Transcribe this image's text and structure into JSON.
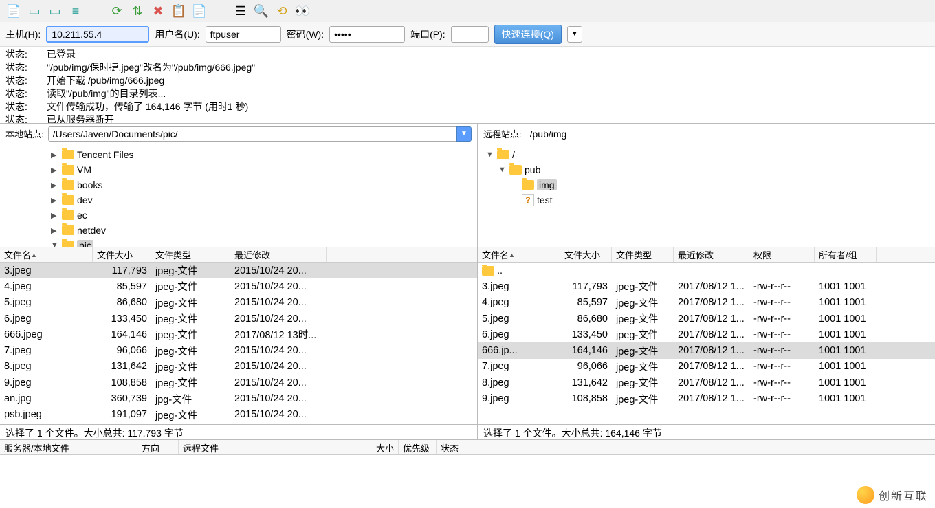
{
  "connect": {
    "host_label": "主机(H):",
    "host_value": "10.211.55.4",
    "user_label": "用户名(U):",
    "user_value": "ftpuser",
    "pass_label": "密码(W):",
    "pass_value": "•••••",
    "port_label": "端口(P):",
    "port_value": "",
    "quick_connect": "快速连接(Q)"
  },
  "log": [
    {
      "label": "状态:",
      "msg": "已登录"
    },
    {
      "label": "状态:",
      "msg": "\"/pub/img/保时捷.jpeg\"改名为\"/pub/img/666.jpeg\""
    },
    {
      "label": "状态:",
      "msg": "开始下载 /pub/img/666.jpeg"
    },
    {
      "label": "状态:",
      "msg": "读取\"/pub/img\"的目录列表..."
    },
    {
      "label": "状态:",
      "msg": "文件传输成功，传输了 164,146 字节 (用时1 秒)"
    },
    {
      "label": "状态:",
      "msg": "已从服务器断开"
    }
  ],
  "local_site_label": "本地站点:",
  "local_site_path": "/Users/Javen/Documents/pic/",
  "remote_site_label": "远程站点:",
  "remote_site_path": "/pub/img",
  "local_tree": [
    {
      "name": "Tencent Files",
      "indent": 3,
      "expand": "▶"
    },
    {
      "name": "VM",
      "indent": 3,
      "expand": "▶"
    },
    {
      "name": "books",
      "indent": 3,
      "expand": "▶"
    },
    {
      "name": "dev",
      "indent": 3,
      "expand": "▶"
    },
    {
      "name": "ec",
      "indent": 3,
      "expand": "▶"
    },
    {
      "name": "netdev",
      "indent": 3,
      "expand": "▶"
    },
    {
      "name": "pic",
      "indent": 3,
      "expand": "▼",
      "selected": true
    }
  ],
  "remote_tree": [
    {
      "name": "/",
      "indent": 0,
      "expand": "▼",
      "type": "folder"
    },
    {
      "name": "pub",
      "indent": 1,
      "expand": "▼",
      "type": "folder"
    },
    {
      "name": "img",
      "indent": 2,
      "expand": "",
      "type": "folder",
      "selected": true
    },
    {
      "name": "test",
      "indent": 2,
      "expand": "",
      "type": "file-q"
    }
  ],
  "list_headers": {
    "name": "文件名",
    "size": "文件大小",
    "type": "文件类型",
    "date": "最近修改",
    "perm": "权限",
    "owner": "所有者/组"
  },
  "local_files": [
    {
      "name": "3.jpeg",
      "size": "117,793",
      "type": "jpeg-文件",
      "date": "2015/10/24 20...",
      "selected": true
    },
    {
      "name": "4.jpeg",
      "size": "85,597",
      "type": "jpeg-文件",
      "date": "2015/10/24 20..."
    },
    {
      "name": "5.jpeg",
      "size": "86,680",
      "type": "jpeg-文件",
      "date": "2015/10/24 20..."
    },
    {
      "name": "6.jpeg",
      "size": "133,450",
      "type": "jpeg-文件",
      "date": "2015/10/24 20..."
    },
    {
      "name": "666.jpeg",
      "size": "164,146",
      "type": "jpeg-文件",
      "date": "2017/08/12 13时..."
    },
    {
      "name": "7.jpeg",
      "size": "96,066",
      "type": "jpeg-文件",
      "date": "2015/10/24 20..."
    },
    {
      "name": "8.jpeg",
      "size": "131,642",
      "type": "jpeg-文件",
      "date": "2015/10/24 20..."
    },
    {
      "name": "9.jpeg",
      "size": "108,858",
      "type": "jpeg-文件",
      "date": "2015/10/24 20..."
    },
    {
      "name": "an.jpg",
      "size": "360,739",
      "type": "jpg-文件",
      "date": "2015/10/24 20..."
    },
    {
      "name": "psb.jpeg",
      "size": "191,097",
      "type": "jpeg-文件",
      "date": "2015/10/24 20..."
    }
  ],
  "remote_files": [
    {
      "name": "..",
      "parent": true
    },
    {
      "name": "3.jpeg",
      "size": "117,793",
      "type": "jpeg-文件",
      "date": "2017/08/12 1...",
      "perm": "-rw-r--r--",
      "owner": "1001 1001"
    },
    {
      "name": "4.jpeg",
      "size": "85,597",
      "type": "jpeg-文件",
      "date": "2017/08/12 1...",
      "perm": "-rw-r--r--",
      "owner": "1001 1001"
    },
    {
      "name": "5.jpeg",
      "size": "86,680",
      "type": "jpeg-文件",
      "date": "2017/08/12 1...",
      "perm": "-rw-r--r--",
      "owner": "1001 1001"
    },
    {
      "name": "6.jpeg",
      "size": "133,450",
      "type": "jpeg-文件",
      "date": "2017/08/12 1...",
      "perm": "-rw-r--r--",
      "owner": "1001 1001"
    },
    {
      "name": "666.jp...",
      "size": "164,146",
      "type": "jpeg-文件",
      "date": "2017/08/12 1...",
      "perm": "-rw-r--r--",
      "owner": "1001 1001",
      "selected": true
    },
    {
      "name": "7.jpeg",
      "size": "96,066",
      "type": "jpeg-文件",
      "date": "2017/08/12 1...",
      "perm": "-rw-r--r--",
      "owner": "1001 1001"
    },
    {
      "name": "8.jpeg",
      "size": "131,642",
      "type": "jpeg-文件",
      "date": "2017/08/12 1...",
      "perm": "-rw-r--r--",
      "owner": "1001 1001"
    },
    {
      "name": "9.jpeg",
      "size": "108,858",
      "type": "jpeg-文件",
      "date": "2017/08/12 1...",
      "perm": "-rw-r--r--",
      "owner": "1001 1001"
    }
  ],
  "local_status": "选择了 1 个文件。大小总共: 117,793 字节",
  "remote_status": "选择了 1 个文件。大小总共: 164,146 字节",
  "queue_headers": {
    "file": "服务器/本地文件",
    "dir": "方向",
    "remote": "远程文件",
    "size": "大小",
    "pri": "优先级",
    "stat": "状态"
  },
  "watermark": "创新互联"
}
